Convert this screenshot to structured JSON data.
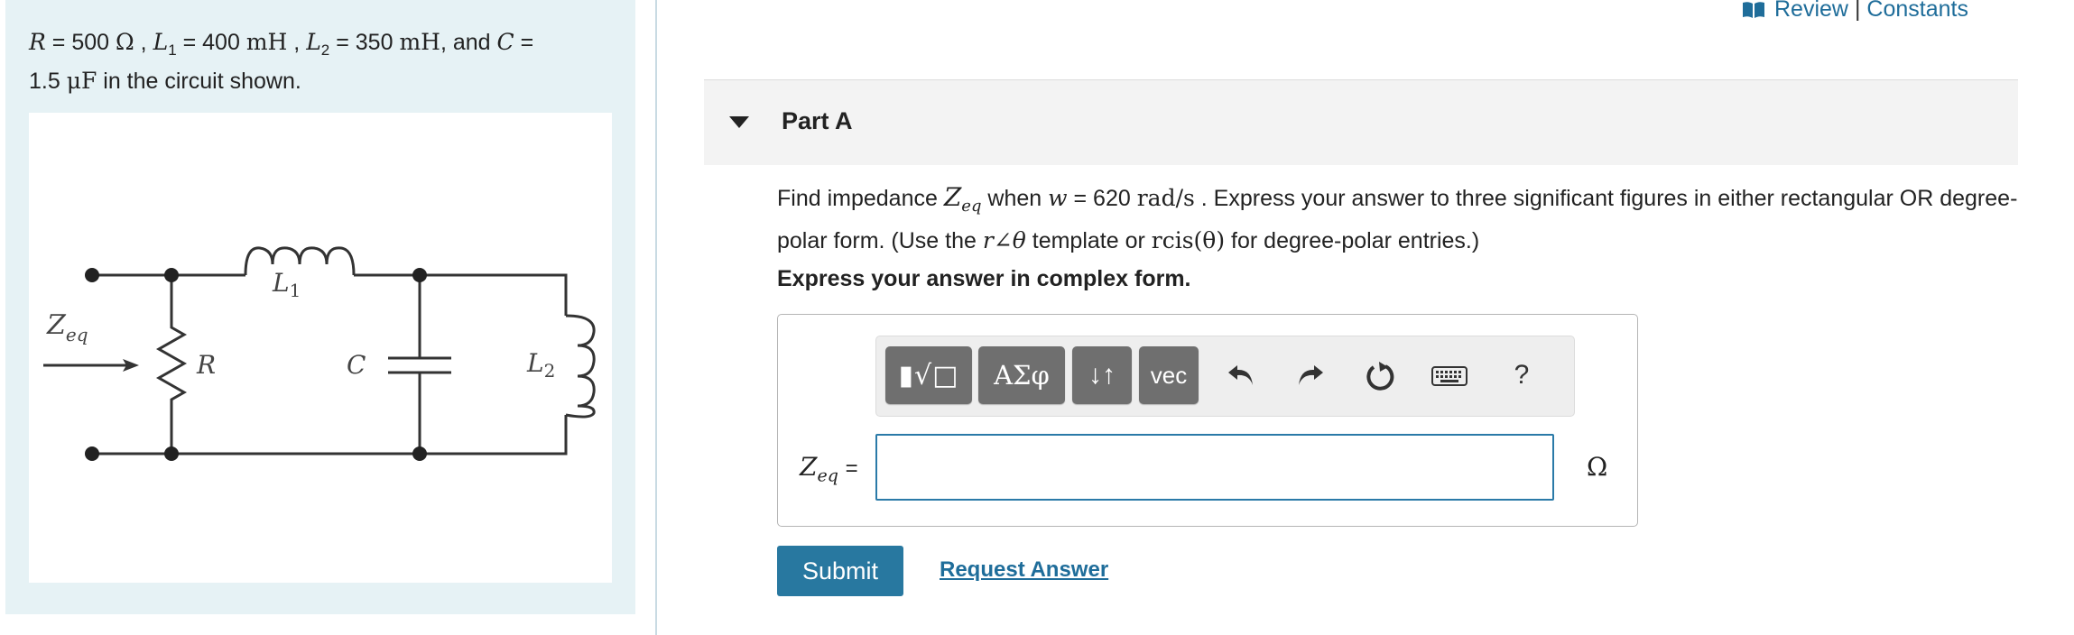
{
  "problem": {
    "R_symbol": "R",
    "R_val": "500",
    "R_unit": "Ω",
    "L1_symbol": "L",
    "L1_sub": "1",
    "L1_val": "400",
    "L1_unit": "mH",
    "L2_symbol": "L",
    "L2_sub": "2",
    "L2_val": "350",
    "L2_unit": "mH",
    "and_text": ", and",
    "C_symbol": "C",
    "C_val": "1.5",
    "C_unit": "μF",
    "tail": " in the circuit shown."
  },
  "circuit": {
    "zeq_main": "Z",
    "zeq_sub": "eq",
    "r_label": "R",
    "c_label": "C",
    "l1_main": "L",
    "l1_sub": "1",
    "l2_main": "L",
    "l2_sub": "2"
  },
  "top_links": {
    "review": "Review",
    "sep": "|",
    "constants": "Constants"
  },
  "part": {
    "title": "Part A"
  },
  "question": {
    "t1": "Find impedance ",
    "zmain": "Z",
    "zsub": "eq",
    "t2": " when ",
    "w": "w",
    "t3": " = 620 ",
    "unit": "rad/s",
    "t4": " .  Express your answer to three significant figures in either rectangular OR degree-polar form.  (Use the ",
    "polar": "r∠θ",
    "t5": " template or ",
    "rcis": "rcis(θ)",
    "t6": " for degree-polar entries.)"
  },
  "instruction": "Express your answer in complex form.",
  "toolbar": {
    "templates_label": "▮√□",
    "greek_label": "ΑΣφ",
    "arrows_label": "↓↑",
    "vec_label": "vec",
    "help_label": "?"
  },
  "answer": {
    "label_main": "Z",
    "label_sub": "eq",
    "equals": "=",
    "value": "",
    "unit": "Ω"
  },
  "buttons": {
    "submit": "Submit",
    "request": "Request Answer"
  },
  "colors": {
    "panel_bg": "#e6f2f5",
    "accent_blue": "#2878a0",
    "link_blue": "#1f6d9a",
    "toolbar_button": "#6f6f6f"
  }
}
